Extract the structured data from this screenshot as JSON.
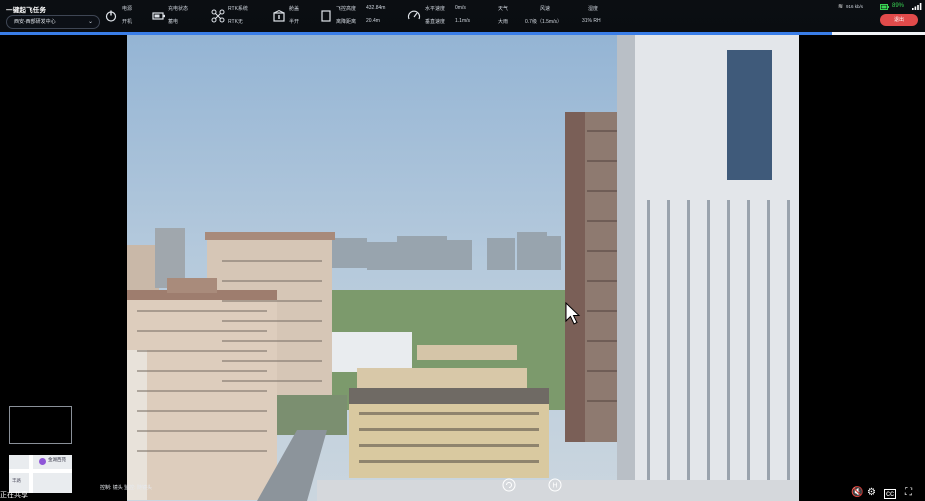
{
  "mission": {
    "title": "一键起飞任务",
    "site": "西安-西部研发中心"
  },
  "stats": {
    "power": {
      "label": "电源",
      "value": "开机"
    },
    "charge": {
      "label": "充电状态",
      "value": "蓄电"
    },
    "rtk": {
      "label": "RTK系统",
      "value": "RTK无"
    },
    "hatch": {
      "label": "舱盖",
      "value": "半开"
    },
    "altitude": {
      "label1": "飞控高度",
      "value1": "432.84m",
      "label2": "离降距离",
      "value2": "20.4m"
    },
    "speed": {
      "label1": "水平速度",
      "value1": "0m/s",
      "label2": "垂直速度",
      "value2": "1.1m/s"
    },
    "weather": {
      "label": "天气",
      "value": "大雨"
    },
    "wind": {
      "label": "风速",
      "value": "0.7级（1.5m/s）"
    },
    "humidity": {
      "label": "湿度",
      "value": "31% RH"
    }
  },
  "right_status": {
    "net": "916 kb/s",
    "battery": "89%",
    "logout": "退出"
  },
  "left_panel": {
    "map_poi": "金湖西苑",
    "map_place": "丰路",
    "sharing": "正在共享"
  },
  "bottom": {
    "control_text": "控制: 镜头    监控: 随镜头"
  },
  "colors": {
    "accent_blue": "#3a7ee8",
    "logout_red": "#e14b4b",
    "battery_green": "#39d353"
  }
}
